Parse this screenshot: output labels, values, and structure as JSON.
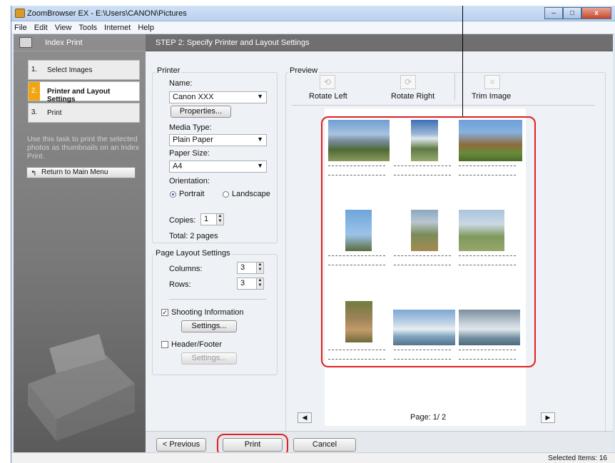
{
  "window": {
    "title": "ZoomBrowser EX  -  E:\\Users\\CANON\\Pictures",
    "minimize": "–",
    "maximize": "□",
    "close": "x"
  },
  "menu": [
    "File",
    "Edit",
    "View",
    "Tools",
    "Internet",
    "Help"
  ],
  "sidebar": {
    "title": "Index Print",
    "steps": [
      {
        "num": "1.",
        "label": "Select Images"
      },
      {
        "num": "2.",
        "label": "Printer and Layout Settings"
      },
      {
        "num": "3.",
        "label": "Print"
      }
    ],
    "description": "Use this task to print the selected photos as thumbnails on an Index Print.",
    "return_label": "Return to Main Menu"
  },
  "main": {
    "step_title": "STEP 2: Specify Printer and Layout Settings",
    "printer": {
      "group_label": "Printer",
      "name_label": "Name:",
      "name_value": "Canon XXX",
      "properties_btn": "Properties...",
      "media_label": "Media Type:",
      "media_value": "Plain Paper",
      "size_label": "Paper Size:",
      "size_value": "A4",
      "orientation_label": "Orientation:",
      "portrait_label": "Portrait",
      "landscape_label": "Landscape",
      "copies_label": "Copies:",
      "copies_value": "1",
      "total_label": "Total: 2 pages"
    },
    "layout": {
      "group_label": "Page Layout Settings",
      "columns_label": "Columns:",
      "columns_value": "3",
      "rows_label": "Rows:",
      "rows_value": "3",
      "shooting_label": "Shooting Information",
      "shooting_settings_btn": "Settings...",
      "header_label": "Header/Footer",
      "header_settings_btn": "Settings..."
    },
    "preview": {
      "group_label": "Preview",
      "rotate_left": "Rotate Left",
      "rotate_right": "Rotate Right",
      "trim_image": "Trim Image",
      "page_label": "Page: 1/ 2",
      "prev_arrow": "◀",
      "next_arrow": "▶"
    }
  },
  "bottom": {
    "previous_btn": "< Previous",
    "print_btn": "Print",
    "cancel_btn": "Cancel"
  },
  "status": {
    "selected": "Selected Items: 16"
  }
}
